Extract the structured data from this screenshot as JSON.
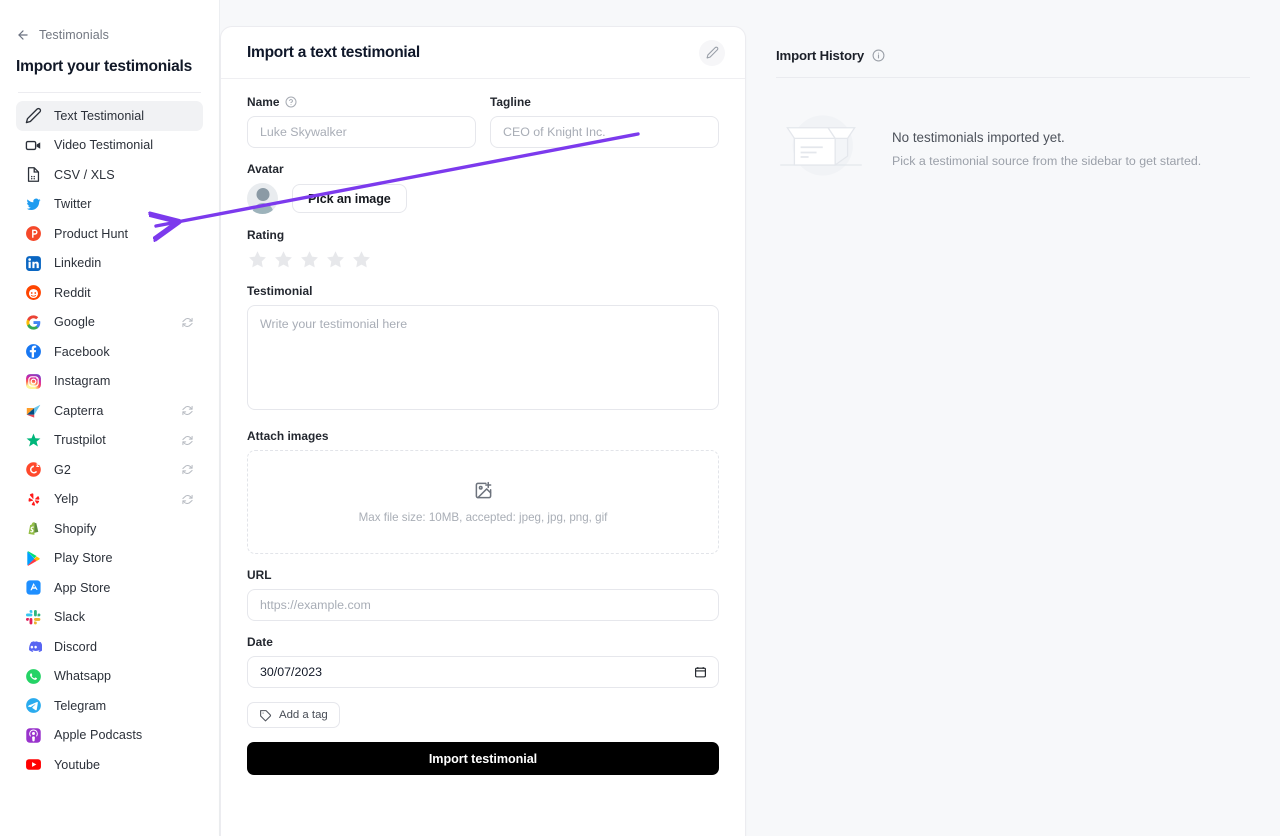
{
  "sidebar": {
    "back_label": "Testimonials",
    "title": "Import your testimonials",
    "items": [
      {
        "label": "Text Testimonial",
        "icon": "pencil-icon",
        "active": true,
        "sync": false
      },
      {
        "label": "Video Testimonial",
        "icon": "video-camera-icon",
        "active": false,
        "sync": false
      },
      {
        "label": "CSV / XLS",
        "icon": "file-icon",
        "active": false,
        "sync": false
      },
      {
        "label": "Twitter",
        "icon": "twitter-icon",
        "active": false,
        "sync": false
      },
      {
        "label": "Product Hunt",
        "icon": "product-hunt-icon",
        "active": false,
        "sync": false
      },
      {
        "label": "Linkedin",
        "icon": "linkedin-icon",
        "active": false,
        "sync": false
      },
      {
        "label": "Reddit",
        "icon": "reddit-icon",
        "active": false,
        "sync": false
      },
      {
        "label": "Google",
        "icon": "google-icon",
        "active": false,
        "sync": true
      },
      {
        "label": "Facebook",
        "icon": "facebook-icon",
        "active": false,
        "sync": false
      },
      {
        "label": "Instagram",
        "icon": "instagram-icon",
        "active": false,
        "sync": false
      },
      {
        "label": "Capterra",
        "icon": "capterra-icon",
        "active": false,
        "sync": true
      },
      {
        "label": "Trustpilot",
        "icon": "trustpilot-icon",
        "active": false,
        "sync": true
      },
      {
        "label": "G2",
        "icon": "g2-icon",
        "active": false,
        "sync": true
      },
      {
        "label": "Yelp",
        "icon": "yelp-icon",
        "active": false,
        "sync": true
      },
      {
        "label": "Shopify",
        "icon": "shopify-icon",
        "active": false,
        "sync": false
      },
      {
        "label": "Play Store",
        "icon": "play-store-icon",
        "active": false,
        "sync": false
      },
      {
        "label": "App Store",
        "icon": "app-store-icon",
        "active": false,
        "sync": false
      },
      {
        "label": "Slack",
        "icon": "slack-icon",
        "active": false,
        "sync": false
      },
      {
        "label": "Discord",
        "icon": "discord-icon",
        "active": false,
        "sync": false
      },
      {
        "label": "Whatsapp",
        "icon": "whatsapp-icon",
        "active": false,
        "sync": false
      },
      {
        "label": "Telegram",
        "icon": "telegram-icon",
        "active": false,
        "sync": false
      },
      {
        "label": "Apple Podcasts",
        "icon": "apple-podcasts-icon",
        "active": false,
        "sync": false
      },
      {
        "label": "Youtube",
        "icon": "youtube-icon",
        "active": false,
        "sync": false
      }
    ]
  },
  "form": {
    "card_title": "Import a text testimonial",
    "name": {
      "label": "Name",
      "value": "",
      "placeholder": "Luke Skywalker"
    },
    "tagline": {
      "label": "Tagline",
      "value": "",
      "placeholder": "CEO of Knight Inc."
    },
    "avatar": {
      "label": "Avatar",
      "pick_label": "Pick an image"
    },
    "rating": {
      "label": "Rating",
      "value": 0,
      "max": 5
    },
    "testimonial": {
      "label": "Testimonial",
      "value": "",
      "placeholder": "Write your testimonial here"
    },
    "attach": {
      "label": "Attach images",
      "hint": "Max file size: 10MB, accepted: jpeg, jpg, png, gif"
    },
    "url": {
      "label": "URL",
      "value": "",
      "placeholder": "https://example.com"
    },
    "date": {
      "label": "Date",
      "value": "30/07/2023"
    },
    "tag_button": "Add a tag",
    "submit_button": "Import testimonial"
  },
  "history": {
    "title": "Import History",
    "empty_title": "No testimonials imported yet.",
    "empty_subtitle": "Pick a testimonial source from the sidebar to get started."
  },
  "annotation": {
    "color": "#7c3aed"
  }
}
